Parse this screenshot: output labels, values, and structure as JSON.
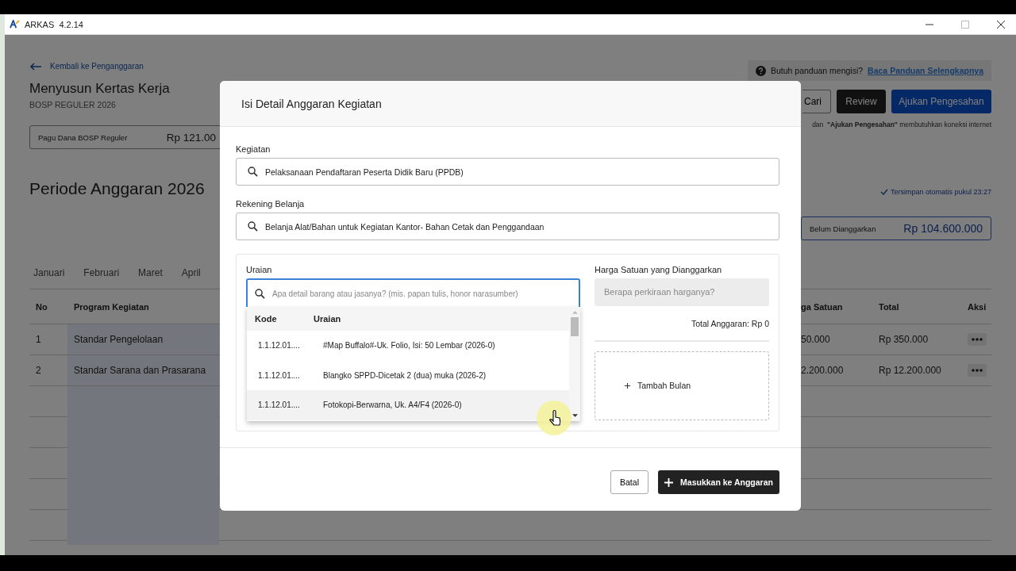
{
  "window": {
    "title": "ARKAS  4.2.14"
  },
  "page": {
    "back_link": "Kembali ke Penganggaran",
    "title": "Menyusun Kertas Kerja",
    "subtitle": "BOSP REGULER 2026",
    "budget_card": {
      "label": "Pagu Dana BOSP Reguler",
      "amount": "Rp 121.00"
    },
    "period_title": "Periode Anggaran 2026",
    "month_tabs": [
      {
        "label": "Januari",
        "selected": false
      },
      {
        "label": "Februari",
        "selected": false
      },
      {
        "label": "Maret",
        "selected": false
      },
      {
        "label": "April",
        "selected": false
      }
    ],
    "help": {
      "text": "Butuh panduan mengisi?",
      "link": "Baca Panduan Selengkapnya"
    },
    "buttons": [
      {
        "label": "Cari",
        "kind": "outline"
      },
      {
        "label": "Review",
        "kind": "dark"
      },
      {
        "label": "Ajukan Pengesahan",
        "kind": "primary"
      }
    ],
    "note": "dan  **\"Ajukan Pengesahan\"** membutuhkan koneksi internet",
    "autosave": "Tersimpan otomatis pukul 23:27",
    "unallocated_card": {
      "label": "Belum Dianggarkan",
      "amount": "Rp 104.600.000"
    },
    "table": {
      "columns": [
        "No",
        "Program Kegiatan",
        "ga Satuan",
        "Total",
        "Aksi"
      ],
      "rows": [
        [
          "1",
          "Standar Pengelolaan",
          "50.000",
          "Rp 350.000"
        ],
        [
          "2",
          "Standar Sarana dan Prasarana",
          "2.200.000",
          "Rp 12.200.000"
        ]
      ]
    }
  },
  "dialog": {
    "title": "Isi Detail Anggaran Kegiatan",
    "kegiatan": {
      "label": "Kegiatan",
      "value": "Pelaksanaan Pendaftaran Peserta Didik Baru (PPDB)"
    },
    "rekening": {
      "label": "Rekening Belanja",
      "value": "Belanja Alat/Bahan untuk Kegiatan Kantor- Bahan Cetak dan Penggandaan"
    },
    "uraian": {
      "label": "Uraian",
      "placeholder": "Apa detail barang atau jasanya? (mis. papan tulis, honor narasumber)",
      "focused": true
    },
    "harga": {
      "label": "Harga Satuan yang Dianggarkan",
      "placeholder": "Berapa perkiraan harganya?"
    },
    "total": "Total Anggaran: Rp 0",
    "add_month": "Tambah Bulan",
    "dropdown": {
      "columns": [
        "Kode",
        "Uraian"
      ],
      "rows": [
        {
          "code": "1.1.12.01....",
          "text": "#Map Buffalo#-Uk. Folio, Isi: 50 Lembar (2026-0)",
          "hovered": false
        },
        {
          "code": "1.1.12.01....",
          "text": "Blangko SPPD-Dicetak 2 (dua) muka (2026-2)",
          "hovered": false
        },
        {
          "code": "1.1.12.01....",
          "text": "Fotokopi-Berwarna, Uk. A4/F4 (2026-0)",
          "hovered": true
        }
      ]
    },
    "cancel": "Batal",
    "submit": "Masukkan ke Anggaran"
  }
}
